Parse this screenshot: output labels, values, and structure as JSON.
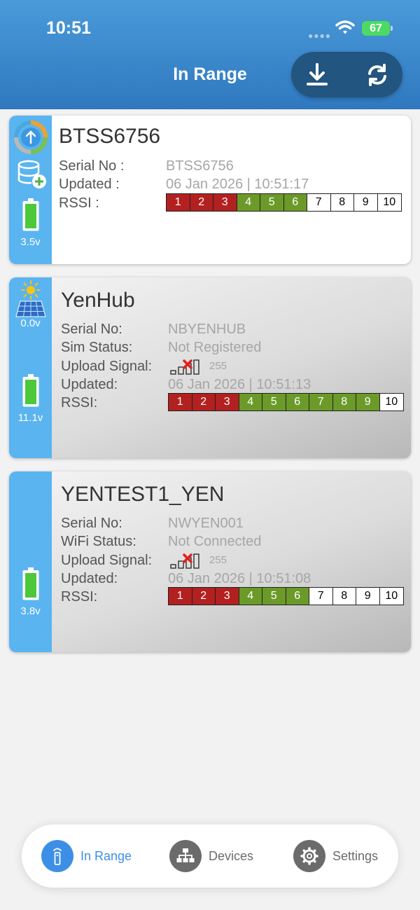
{
  "status_bar": {
    "time": "10:51",
    "battery": "67"
  },
  "header": {
    "title": "In Range"
  },
  "cards": [
    {
      "name": "BTSS6756",
      "serial_label": "Serial No :",
      "serial": "BTSS6756",
      "updated_label": "Updated :",
      "updated": "06 Jan 2026 | 10:51:17",
      "rssi_label": "RSSI :",
      "voltage": "3.5v"
    },
    {
      "name": "YenHub",
      "serial_label": "Serial No:",
      "serial": "NBYENHUB",
      "status_label": "Sim Status:",
      "status": "Not Registered",
      "upload_label": "Upload Signal:",
      "upload_value": "255",
      "updated_label": "Updated:",
      "updated": "06 Jan 2026 | 10:51:13",
      "rssi_label": "RSSI:",
      "solar_voltage": "0.0v",
      "voltage": "11.1v"
    },
    {
      "name": "YENTEST1_YEN",
      "serial_label": "Serial No:",
      "serial": "NWYEN001",
      "status_label": "WiFi Status:",
      "status": "Not Connected",
      "upload_label": "Upload Signal:",
      "upload_value": "255",
      "updated_label": "Updated:",
      "updated": "06 Jan 2026 | 10:51:08",
      "rssi_label": "RSSI:",
      "voltage": "3.8v"
    }
  ],
  "rssi_scale": [
    "1",
    "2",
    "3",
    "4",
    "5",
    "6",
    "7",
    "8",
    "9",
    "10"
  ],
  "rssi_levels": [
    6,
    9,
    6
  ],
  "tabs": {
    "in_range": "In Range",
    "devices": "Devices",
    "settings": "Settings"
  },
  "colors": {
    "accent": "#3d8fe6",
    "header": "#3a88cc",
    "side": "#5ab4f0",
    "rssi_red": "#b32020",
    "rssi_green": "#6b9a29"
  },
  "icons": [
    "wifi-icon",
    "download-icon",
    "refresh-icon",
    "upload-cycle-icon",
    "database-add-icon",
    "battery-icon",
    "sun-icon",
    "solar-panel-icon",
    "signal-icon",
    "remote-icon",
    "network-icon",
    "gear-icon"
  ]
}
